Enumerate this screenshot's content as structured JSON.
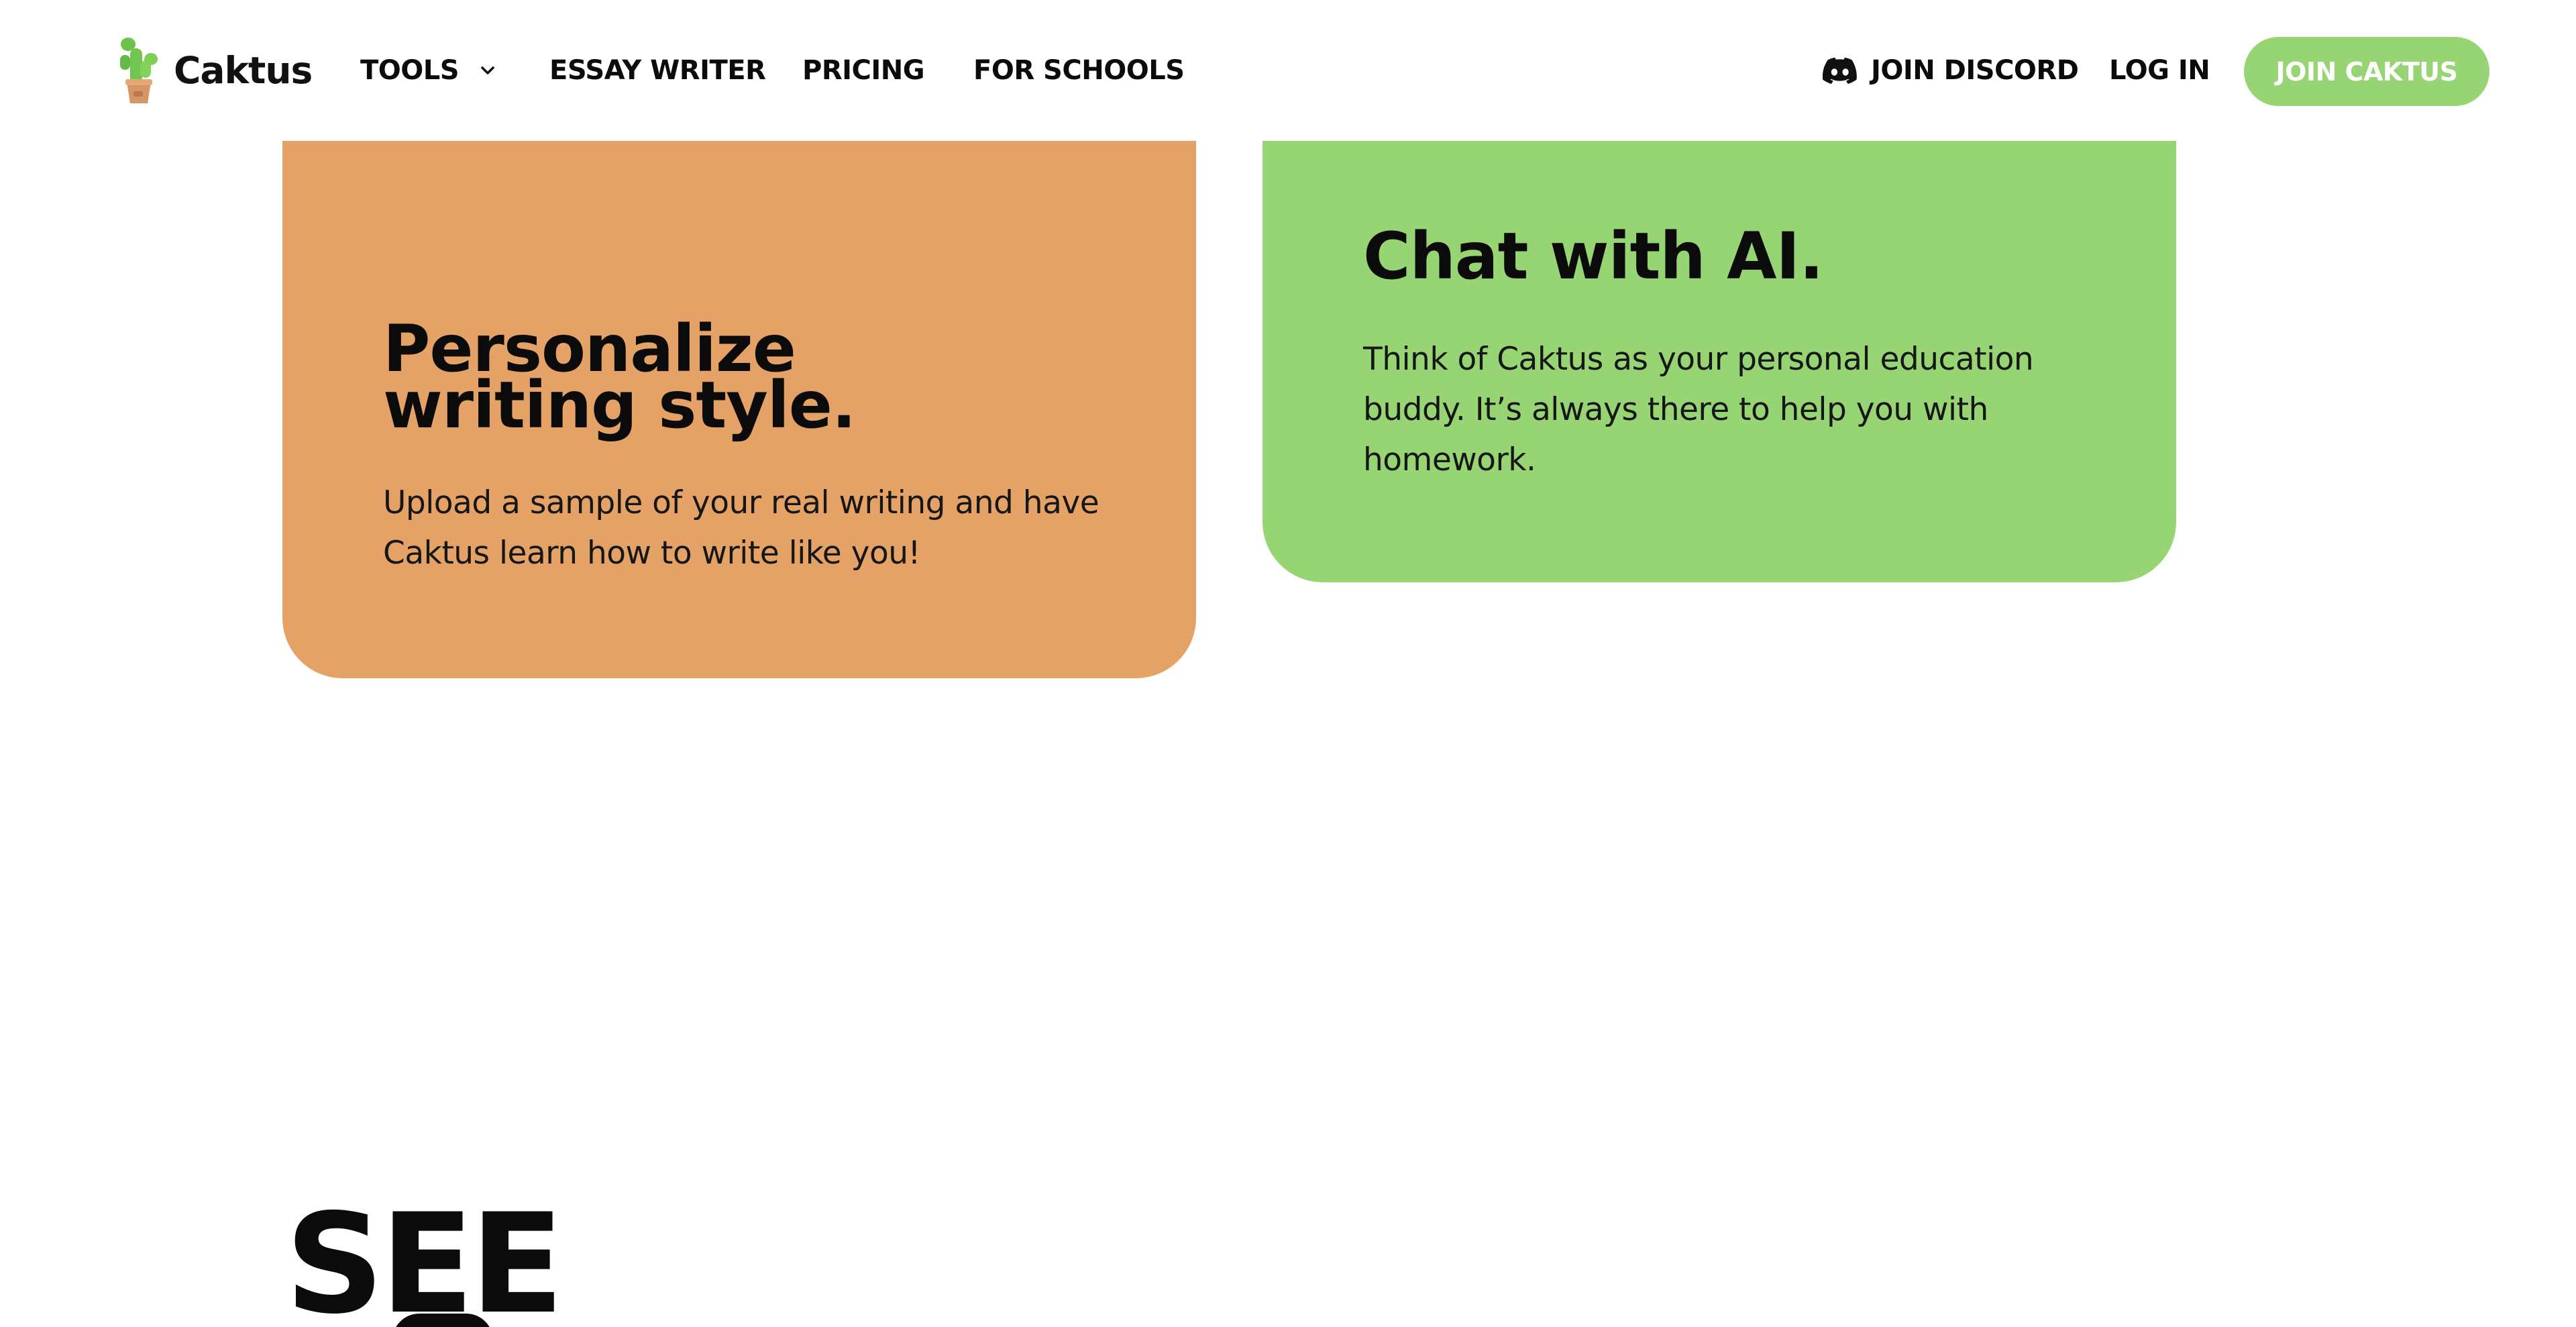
{
  "brand": {
    "name": "Caktus",
    "logo_icon": "cactus-pot-icon",
    "accent_color": "#97d474",
    "orange_color": "#e5a266"
  },
  "nav": {
    "tools_label": "TOOLS",
    "tools_icon": "chevron-down-icon",
    "essay_writer_label": "ESSAY WRITER",
    "pricing_label": "PRICING",
    "for_schools_label": "FOR SCHOOLS",
    "discord_label": "JOIN DISCORD",
    "discord_icon": "discord-icon",
    "login_label": "LOG IN",
    "cta_label": "JOIN CAKTUS"
  },
  "features": [
    {
      "title_line1": "Personalize",
      "title_line2": "writing style.",
      "body_line1": "Upload a sample of your real writing and have",
      "body_line2": "Caktus learn how to write like you!"
    },
    {
      "title": "Chat with AI.",
      "body_line1": "Think of Caktus as your personal education",
      "body_line2": "buddy. It’s always there to help you with",
      "body_line3": "homework."
    }
  ],
  "next_section": {
    "heading": "SEE"
  }
}
